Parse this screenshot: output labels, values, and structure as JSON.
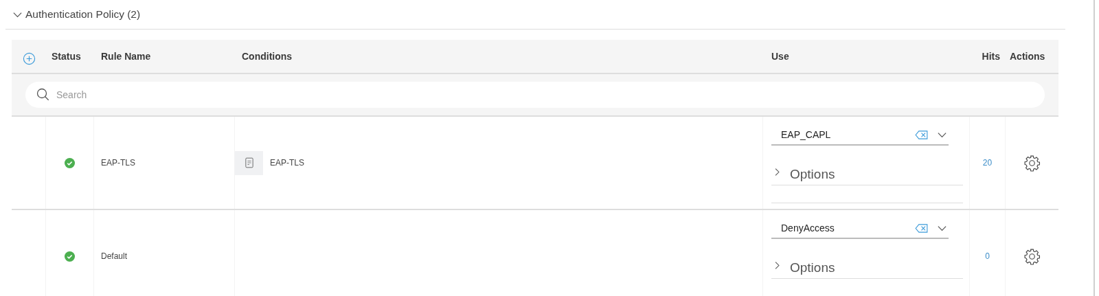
{
  "section": {
    "title": "Authentication Policy (2)",
    "expanded": true
  },
  "table": {
    "columns": [
      "Status",
      "Rule Name",
      "Conditions",
      "Use",
      "Hits",
      "Actions"
    ],
    "search": {
      "placeholder": "Search"
    },
    "rows": [
      {
        "enabled": true,
        "rule_name": "EAP-TLS",
        "condition": "EAP-TLS",
        "use": "EAP_CAPL",
        "options": {
          "label": "Options",
          "expanded": false
        },
        "hits": "20"
      },
      {
        "enabled": true,
        "rule_name": "Default",
        "use": "DenyAccess",
        "options": {
          "label": "Options",
          "expanded": false
        },
        "hits": "0"
      }
    ]
  }
}
